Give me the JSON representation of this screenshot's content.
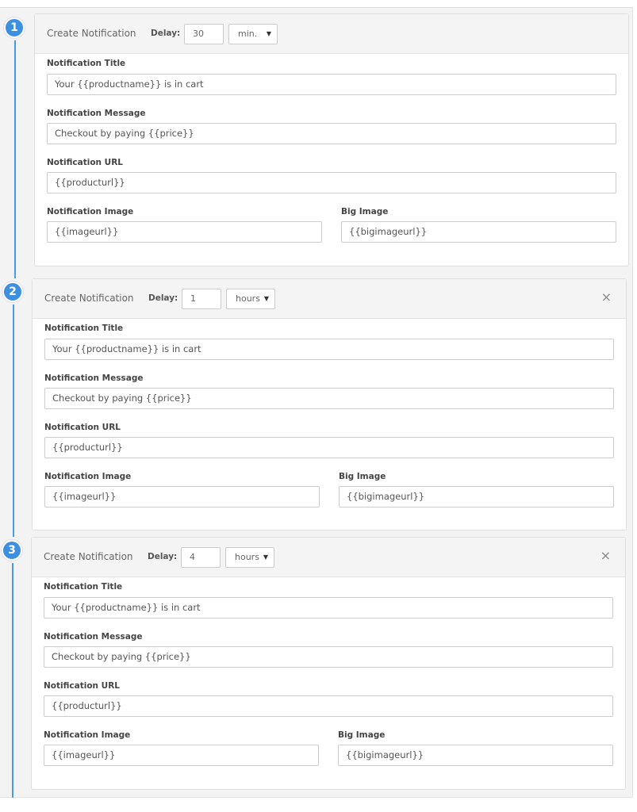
{
  "notifications": [
    {
      "step": "1",
      "title": "Create Notification",
      "delay_label": "Delay:",
      "delay_value": "30",
      "delay_unit": "min.",
      "closable": false,
      "fields": {
        "title_label": "Notification Title",
        "title_value": "Your {{productname}} is in cart",
        "message_label": "Notification Message",
        "message_value": "Checkout by paying {{price}}",
        "url_label": "Notification URL",
        "url_value": "{{producturl}}",
        "image_label": "Notification Image",
        "image_value": "{{imageurl}}",
        "big_image_label": "Big Image",
        "big_image_value": "{{bigimageurl}}"
      }
    },
    {
      "step": "2",
      "title": "Create Notification",
      "delay_label": "Delay:",
      "delay_value": "1",
      "delay_unit": "hours",
      "closable": true,
      "close_glyph": "×",
      "fields": {
        "title_label": "Notification Title",
        "title_value": "Your {{productname}} is in cart",
        "message_label": "Notification Message",
        "message_value": "Checkout by paying {{price}}",
        "url_label": "Notification URL",
        "url_value": "{{producturl}}",
        "image_label": "Notification Image",
        "image_value": "{{imageurl}}",
        "big_image_label": "Big Image",
        "big_image_value": "{{bigimageurl}}"
      }
    },
    {
      "step": "3",
      "title": "Create Notification",
      "delay_label": "Delay:",
      "delay_value": "4",
      "delay_unit": "hours",
      "closable": true,
      "close_glyph": "×",
      "fields": {
        "title_label": "Notification Title",
        "title_value": "Your {{productname}} is in cart",
        "message_label": "Notification Message",
        "message_value": "Checkout by paying {{price}}",
        "url_label": "Notification URL",
        "url_value": "{{producturl}}",
        "image_label": "Notification Image",
        "image_value": "{{imageurl}}",
        "big_image_label": "Big Image",
        "big_image_value": "{{bigimageurl}}"
      }
    }
  ],
  "dropdown_arrow": "▼",
  "colors": {
    "accent": "#3d8fe0",
    "background": "#f3f3f3",
    "card_header": "#f4f4f4"
  }
}
